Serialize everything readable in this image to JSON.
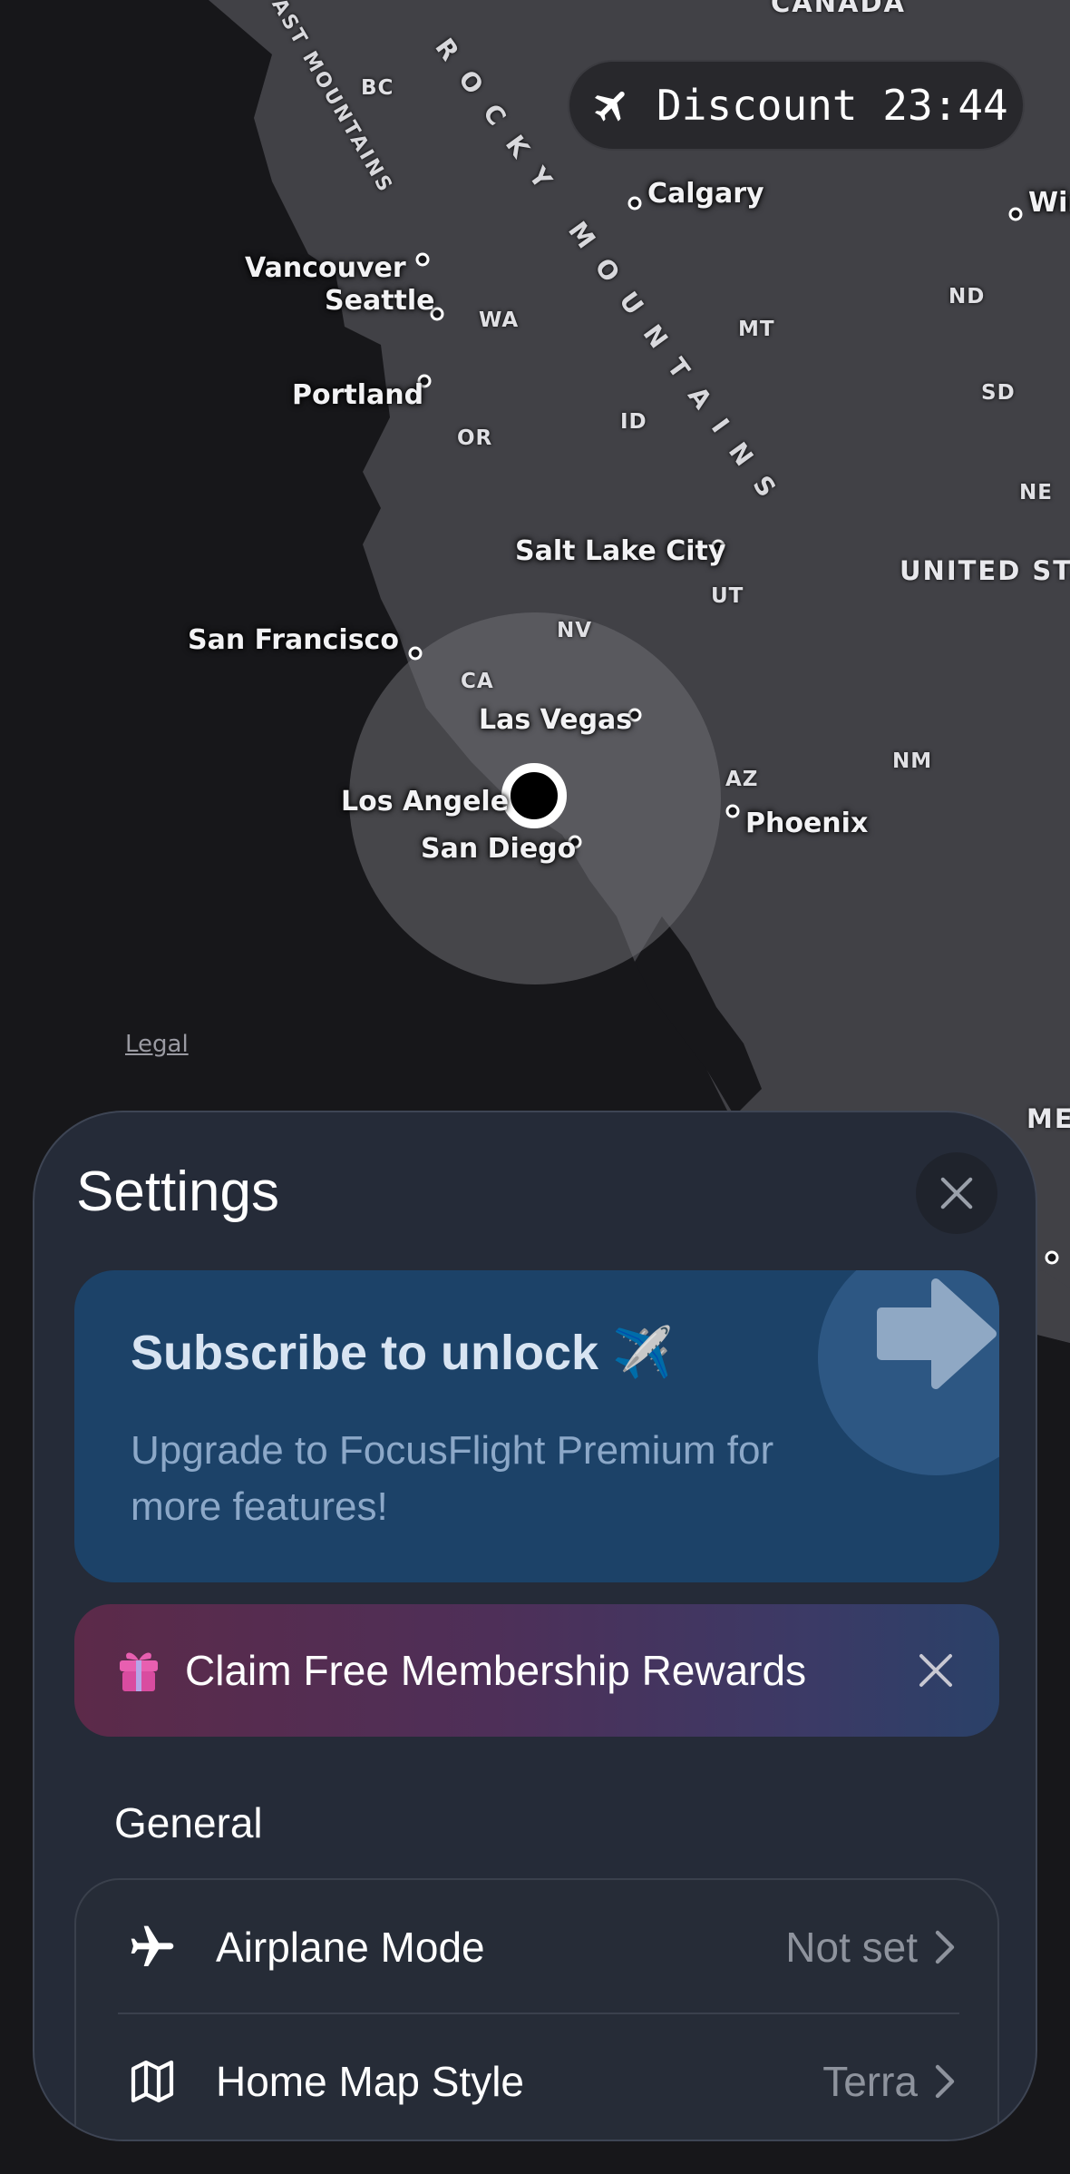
{
  "map": {
    "cities": {
      "vancouver": "Vancouver",
      "seattle": "Seattle",
      "portland": "Portland",
      "calgary": "Calgary",
      "winnipeg": "Wir",
      "salt_lake_city": "Salt Lake City",
      "san_francisco": "San Francisco",
      "las_vegas": "Las Vegas",
      "los_angeles": "Los Angele",
      "san_diego": "San Diego",
      "phoenix": "Phoenix"
    },
    "states": {
      "bc": "BC",
      "wa": "WA",
      "or": "OR",
      "id": "ID",
      "mt": "MT",
      "nd": "ND",
      "sd": "SD",
      "ne": "NE",
      "ut": "UT",
      "nv": "NV",
      "ca": "CA",
      "az": "AZ",
      "nm": "NM"
    },
    "countries": {
      "usa": "UNITED STA",
      "mexico": "MEX",
      "canada": "CANADA"
    },
    "features": {
      "rocky_mountains": "ROCKY MOUNTAINS",
      "coast_mountains": "AST MOUNTAINS"
    },
    "legal_link": "Legal"
  },
  "discount": {
    "icon": "airplane-icon",
    "text": "Discount 23:44"
  },
  "settings": {
    "title": "Settings",
    "close_icon": "close-icon",
    "subscribe_card": {
      "title": "Subscribe to unlock ✈️",
      "description": "Upgrade to FocusFlight Premium for more features!",
      "icon": "arrow-right-icon"
    },
    "claim_banner": {
      "icon": "gift-icon",
      "label": "Claim Free Membership Rewards",
      "dismiss_icon": "close-icon"
    },
    "general_section": {
      "header": "General",
      "rows": [
        {
          "icon": "airplane-icon",
          "label": "Airplane Mode",
          "value": "Not set"
        },
        {
          "icon": "map-icon",
          "label": "Home Map Style",
          "value": "Terra"
        }
      ]
    }
  },
  "colors": {
    "sheet_bg": "#252b38",
    "subscribe_bg": "#1c4268",
    "claim_gradient_start": "#5c2a49",
    "claim_gradient_end": "#2a4168",
    "user_location": "#000000"
  }
}
